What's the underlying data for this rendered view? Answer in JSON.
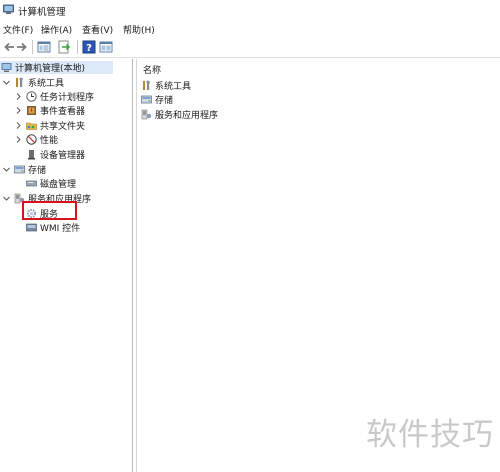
{
  "window": {
    "title": "计算机管理",
    "icon": "computer-management-icon"
  },
  "menubar": {
    "items": [
      {
        "label": "文件(F)"
      },
      {
        "label": "操作(A)"
      },
      {
        "label": "查看(V)"
      },
      {
        "label": "帮助(H)"
      }
    ]
  },
  "toolbar": {
    "buttons": [
      "back-arrow-icon",
      "forward-arrow-icon",
      "show-tree-icon",
      "export-list-icon",
      "help-icon",
      "properties-icon"
    ]
  },
  "tree": {
    "root": {
      "label": "计算机管理(本地)",
      "icon": "computer-icon"
    },
    "system_tools": {
      "label": "系统工具",
      "icon": "tools-icon",
      "children": [
        {
          "label": "任务计划程序",
          "icon": "clock-icon"
        },
        {
          "label": "事件查看器",
          "icon": "event-viewer-icon"
        },
        {
          "label": "共享文件夹",
          "icon": "shared-folder-icon"
        },
        {
          "label": "性能",
          "icon": "performance-icon"
        },
        {
          "label": "设备管理器",
          "icon": "device-manager-icon"
        }
      ]
    },
    "storage": {
      "label": "存储",
      "icon": "storage-icon",
      "children": [
        {
          "label": "磁盘管理",
          "icon": "disk-icon"
        }
      ]
    },
    "services_apps": {
      "label": "服务和应用程序",
      "icon": "services-apps-icon",
      "children": [
        {
          "label": "服务",
          "icon": "services-gear-icon"
        },
        {
          "label": "WMI 控件",
          "icon": "wmi-icon"
        }
      ]
    }
  },
  "main": {
    "column_header": "名称",
    "items": [
      {
        "label": "系统工具",
        "icon": "tools-icon"
      },
      {
        "label": "存储",
        "icon": "storage-icon"
      },
      {
        "label": "服务和应用程序",
        "icon": "services-apps-icon"
      }
    ]
  },
  "watermark": "软件技巧",
  "colors": {
    "highlight_box": "#d8121c",
    "selection": "#dbe9f8",
    "watermark": "#c9c9c9"
  }
}
